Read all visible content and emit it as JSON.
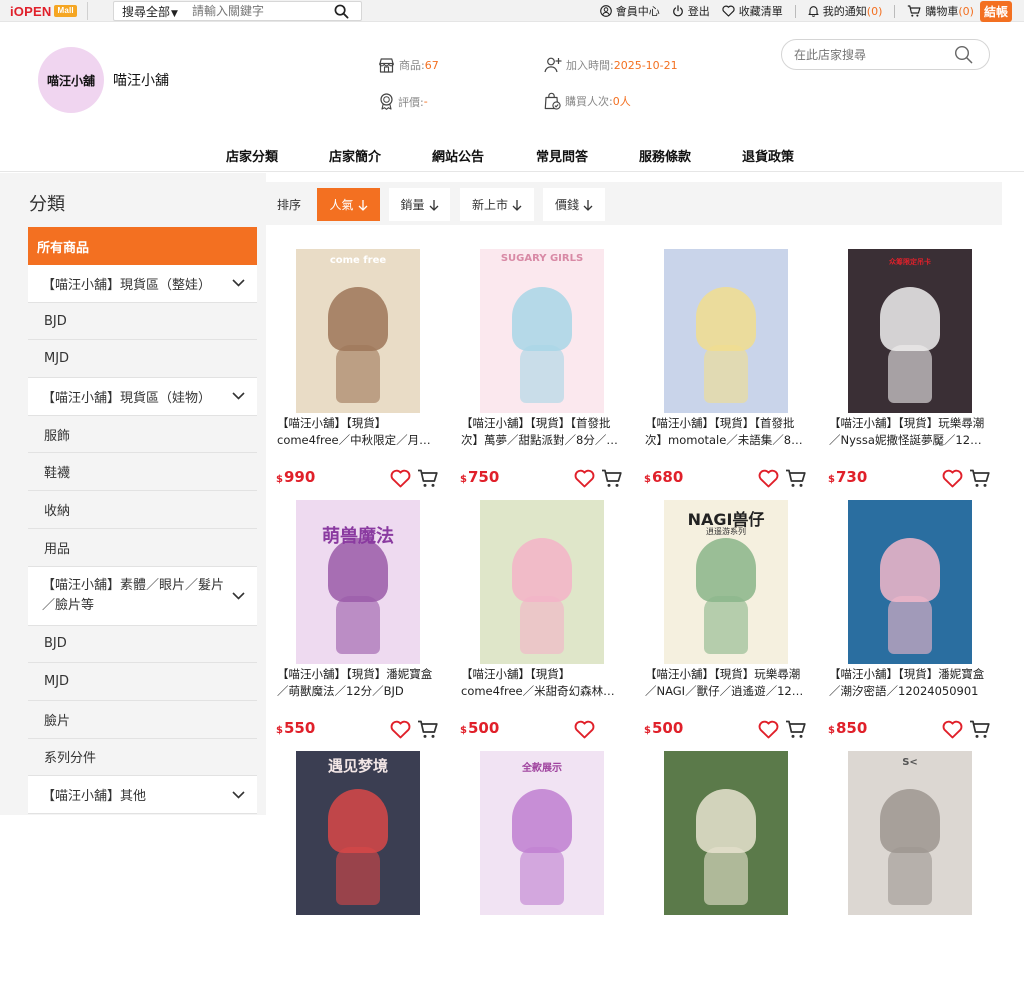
{
  "topbar": {
    "logo_main": "iOPEN",
    "logo_mall": "Mall",
    "search_category": "搜尋全部",
    "search_placeholder": "請輸入關鍵字",
    "links": {
      "member": "會員中心",
      "logout": "登出",
      "favorites": "收藏清單",
      "notifications": "我的通知",
      "notifications_count": "(0)",
      "cart": "購物車",
      "cart_count": "(0)",
      "checkout": "結帳"
    }
  },
  "shop": {
    "avatar_text": "喵汪小舖",
    "name": "喵汪小舖",
    "products_label": "商品:",
    "products_value": "67",
    "joined_label": "加入時間:",
    "joined_value": "2025-10-21",
    "rating_label": "評價:",
    "rating_value": "-",
    "buyers_label": "購買人次:",
    "buyers_value": "0人",
    "store_search_placeholder": "在此店家搜尋"
  },
  "store_nav": [
    "店家分類",
    "店家簡介",
    "網站公告",
    "常見問答",
    "服務條款",
    "退貨政策"
  ],
  "sidebar": {
    "title": "分類",
    "items": [
      {
        "label": "所有商品",
        "kind": "active"
      },
      {
        "label": "【喵汪小舖】現貨區（整娃）",
        "kind": "parent"
      },
      {
        "label": "BJD",
        "kind": "child"
      },
      {
        "label": "MJD",
        "kind": "child"
      },
      {
        "label": "【喵汪小舖】現貨區（娃物）",
        "kind": "parent"
      },
      {
        "label": "服飾",
        "kind": "child"
      },
      {
        "label": "鞋襪",
        "kind": "child"
      },
      {
        "label": "收納",
        "kind": "child"
      },
      {
        "label": "用品",
        "kind": "child"
      },
      {
        "label": "【喵汪小舖】素體／眼片／髮片／臉片等",
        "kind": "parent2"
      },
      {
        "label": "BJD",
        "kind": "child"
      },
      {
        "label": "MJD",
        "kind": "child"
      },
      {
        "label": "臉片",
        "kind": "child"
      },
      {
        "label": "系列分件",
        "kind": "child"
      },
      {
        "label": "【喵汪小舖】其他",
        "kind": "parent"
      }
    ]
  },
  "sortbar": {
    "label": "排序",
    "options": [
      "人氣",
      "銷量",
      "新上市",
      "價錢"
    ],
    "active": "人氣"
  },
  "currency": "$",
  "products": [
    {
      "line1": "【喵汪小舖】【現貨】",
      "line2": "come4free／中秋限定／月綿…",
      "price": "990",
      "image_bg": "#e9dcc6",
      "image_accent": "#9e7658"
    },
    {
      "line1": "【喵汪小舖】【現貨】【首發批",
      "line2": "次】萬夢／甜點派對／8分／…",
      "price": "750",
      "image_bg": "#fbe8ee",
      "image_accent": "#a8d6e6"
    },
    {
      "line1": "【喵汪小舖】【現貨】【首發批",
      "line2": "次】momotale／未語集／8分…",
      "price": "680",
      "image_bg": "#c9d4ea",
      "image_accent": "#f1dd8e"
    },
    {
      "line1": "【喵汪小舖】【現貨】玩樂尋潮",
      "line2": "／Nyssa妮撒怪誕夢魘／12分…",
      "price": "730",
      "image_bg": "#3a2f35",
      "image_accent": "#f0eeee"
    },
    {
      "line1": "【喵汪小舖】【現貨】潘妮寶盒",
      "line2": "／萌獸魔法／12分／BJD",
      "price": "550",
      "image_bg": "#eedaf0",
      "image_accent": "#9a5aa8"
    },
    {
      "line1": "【喵汪小舖】【現貨】",
      "line2": "come4free／米甜奇幻森林／…",
      "price": "500",
      "image_bg": "#dfe6c9",
      "image_accent": "#f4b3c8"
    },
    {
      "line1": "【喵汪小舖】【現貨】玩樂尋潮",
      "line2": "／NAGI／獸仔／逍遙遊／12…",
      "price": "500",
      "image_bg": "#f5f0df",
      "image_accent": "#8ab58a"
    },
    {
      "line1": "【喵汪小舖】【現貨】潘妮寶盒",
      "line2": "／潮汐密語／12024050901",
      "price": "850",
      "image_bg": "#2a6ea0",
      "image_accent": "#f2b7c9"
    },
    {
      "line1": "",
      "line2": "",
      "price": "",
      "image_bg": "#3b3e52",
      "image_accent": "#d84848"
    },
    {
      "line1": "",
      "line2": "",
      "price": "",
      "image_bg": "#f1e3f3",
      "image_accent": "#c07fd0"
    },
    {
      "line1": "",
      "line2": "",
      "price": "",
      "image_bg": "#5b7a4a",
      "image_accent": "#e8e3cf"
    },
    {
      "line1": "",
      "line2": "",
      "price": "",
      "image_bg": "#dcd7d2",
      "image_accent": "#9d9691"
    }
  ],
  "product_image_text": {
    "p1_brand": "come free",
    "p2_banner": "SUGARY GIRLS",
    "p4_badge": "众筹限定吊卡",
    "p5_title": "萌兽魔法",
    "p7_title": "NAGI兽仔",
    "p7_sub": "逍遥游系列",
    "p9_title": "遇见梦境",
    "p10_banner": "全款展示",
    "p12_mark": "S<"
  }
}
